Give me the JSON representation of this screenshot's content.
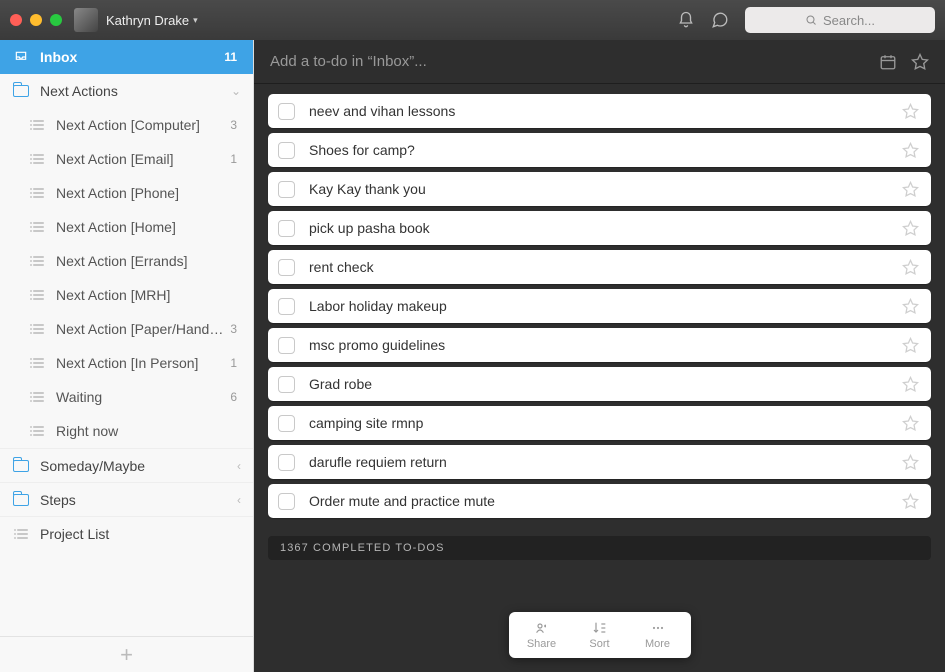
{
  "titlebar": {
    "username": "Kathryn Drake",
    "search_placeholder": "Search..."
  },
  "sidebar": {
    "inbox": {
      "label": "Inbox",
      "count": "11"
    },
    "next_actions": {
      "label": "Next Actions",
      "items": [
        {
          "label": "Next Action [Computer]",
          "count": "3"
        },
        {
          "label": "Next Action [Email]",
          "count": "1"
        },
        {
          "label": "Next Action [Phone]",
          "count": ""
        },
        {
          "label": "Next Action [Home]",
          "count": ""
        },
        {
          "label": "Next Action [Errands]",
          "count": ""
        },
        {
          "label": "Next Action [MRH]",
          "count": ""
        },
        {
          "label": "Next Action [Paper/Handwritt...",
          "count": "3"
        },
        {
          "label": "Next Action [In Person]",
          "count": "1"
        },
        {
          "label": "Waiting",
          "count": "6"
        },
        {
          "label": "Right now",
          "count": ""
        }
      ]
    },
    "someday": {
      "label": "Someday/Maybe"
    },
    "steps": {
      "label": "Steps"
    },
    "project_list": {
      "label": "Project List"
    }
  },
  "addbar": {
    "placeholder": "Add a to-do in “Inbox”..."
  },
  "todos": [
    "neev and vihan lessons",
    "Shoes for camp?",
    "Kay Kay thank you",
    "pick up pasha book",
    "rent check",
    "Labor holiday makeup",
    "msc promo guidelines",
    "Grad robe",
    "camping site rmnp",
    "darufle requiem return",
    "Order mute and practice mute"
  ],
  "completed_label": "1367 COMPLETED TO-DOS",
  "bottom": {
    "share": "Share",
    "sort": "Sort",
    "more": "More"
  }
}
